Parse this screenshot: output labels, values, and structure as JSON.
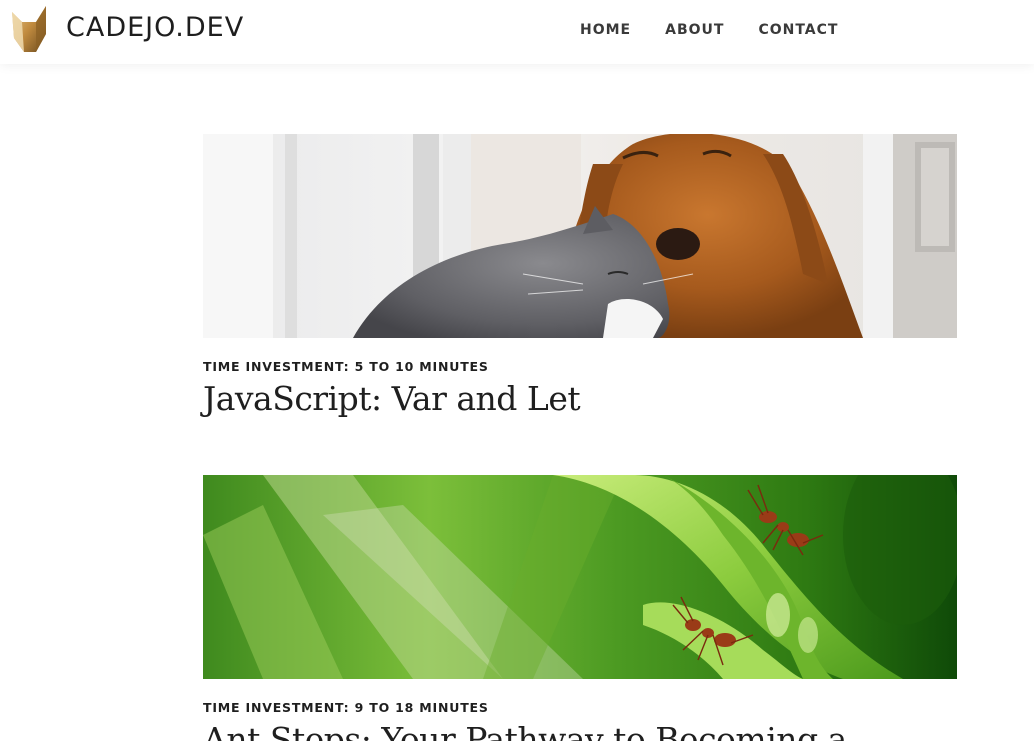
{
  "header": {
    "brand": "CADEJO.DEV",
    "logo_icon": "wolf-logo-icon",
    "nav": [
      {
        "label": "HOME"
      },
      {
        "label": "ABOUT"
      },
      {
        "label": "CONTACT"
      }
    ]
  },
  "posts": [
    {
      "image": "golden-retriever-and-gray-cat-photo",
      "meta": "TIME INVESTMENT: 5 TO 10 MINUTES",
      "title": "JavaScript: Var and Let"
    },
    {
      "image": "ants-on-green-plant-photo",
      "meta": "TIME INVESTMENT: 9 TO 18 MINUTES",
      "title": "Ant Steps: Your Pathway to Becoming a"
    }
  ],
  "colors": {
    "logo_gold": "#c08a3e",
    "text": "#1f1f1f",
    "nav_text": "#3a3a3a"
  }
}
